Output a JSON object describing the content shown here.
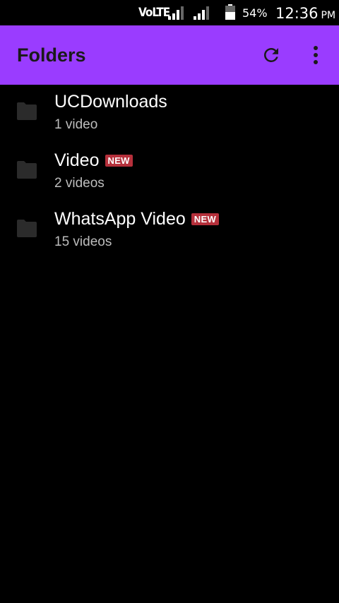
{
  "status_bar": {
    "network": "VoLTE",
    "battery_percent": "54%",
    "time": "12:36",
    "ampm": "PM"
  },
  "app_bar": {
    "title": "Folders",
    "background": "#9a3cff",
    "actions": [
      "refresh-icon",
      "more-vert-icon"
    ]
  },
  "folders": [
    {
      "name": "UCDownloads",
      "count": "1 video",
      "badge": ""
    },
    {
      "name": "Video",
      "count": "2 videos",
      "badge": "NEW"
    },
    {
      "name": "WhatsApp Video",
      "count": "15 videos",
      "badge": "NEW"
    }
  ],
  "colors": {
    "badge": "#b5303b",
    "background": "#000000"
  }
}
